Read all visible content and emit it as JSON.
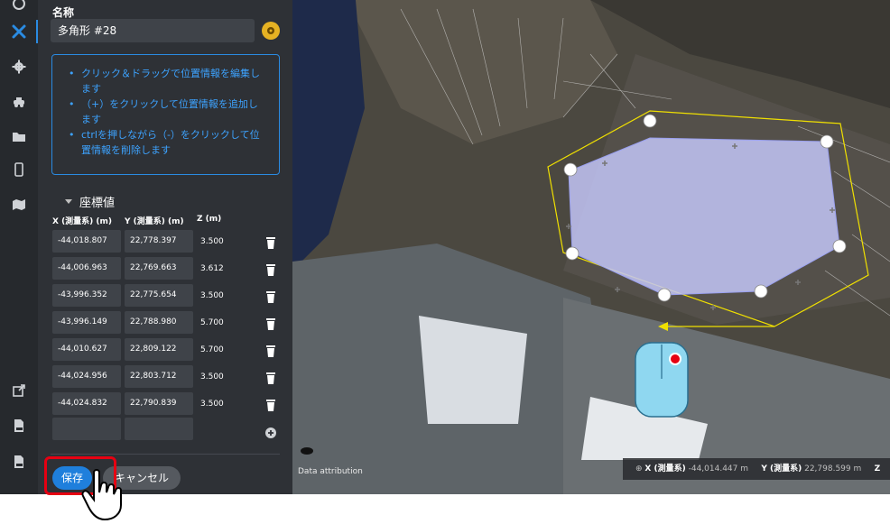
{
  "panel": {
    "name_label": "名称",
    "name_value": "多角形 #28",
    "info": [
      "クリック＆ドラッグで位置情報を編集します",
      "（+）をクリックして位置情報を追加します",
      "ctrlを押しながら（-）をクリックして位置情報を削除します"
    ],
    "coords_title": "座標値",
    "headers": {
      "x": "X (測量系) (m)",
      "y": "Y (測量系) (m)",
      "z": "Z (m)"
    },
    "rows": [
      {
        "x": "-44,018.807",
        "y": "22,778.397",
        "z": "3.500"
      },
      {
        "x": "-44,006.963",
        "y": "22,769.663",
        "z": "3.612"
      },
      {
        "x": "-43,996.352",
        "y": "22,775.654",
        "z": "3.500"
      },
      {
        "x": "-43,996.149",
        "y": "22,788.980",
        "z": "5.700"
      },
      {
        "x": "-44,010.627",
        "y": "22,809.122",
        "z": "5.700"
      },
      {
        "x": "-44,024.956",
        "y": "22,803.712",
        "z": "3.500"
      },
      {
        "x": "-44,024.832",
        "y": "22,790.839",
        "z": "3.500"
      }
    ],
    "save": "保存",
    "cancel": "キャンセル"
  },
  "map": {
    "attribution": "Data attribution",
    "x_label": "X (測量系)",
    "x_value": "-44,014.447 m",
    "y_label": "Y (測量系)",
    "y_value": "22,798.599 m",
    "z_label": "Z"
  },
  "icons": {
    "rail": [
      "wrench-cross-icon",
      "gear-icon",
      "car-icon",
      "folder-icon",
      "mobile-icon",
      "map-icon",
      "external-link-icon",
      "csv-icon",
      "pdf-icon"
    ]
  },
  "colors": {
    "accent": "#2a8be2",
    "info_text": "#3da3ff",
    "polygon_fill": "#c3c6f7",
    "polygon_outline": "#f0e000",
    "highlight": "#e60012"
  }
}
